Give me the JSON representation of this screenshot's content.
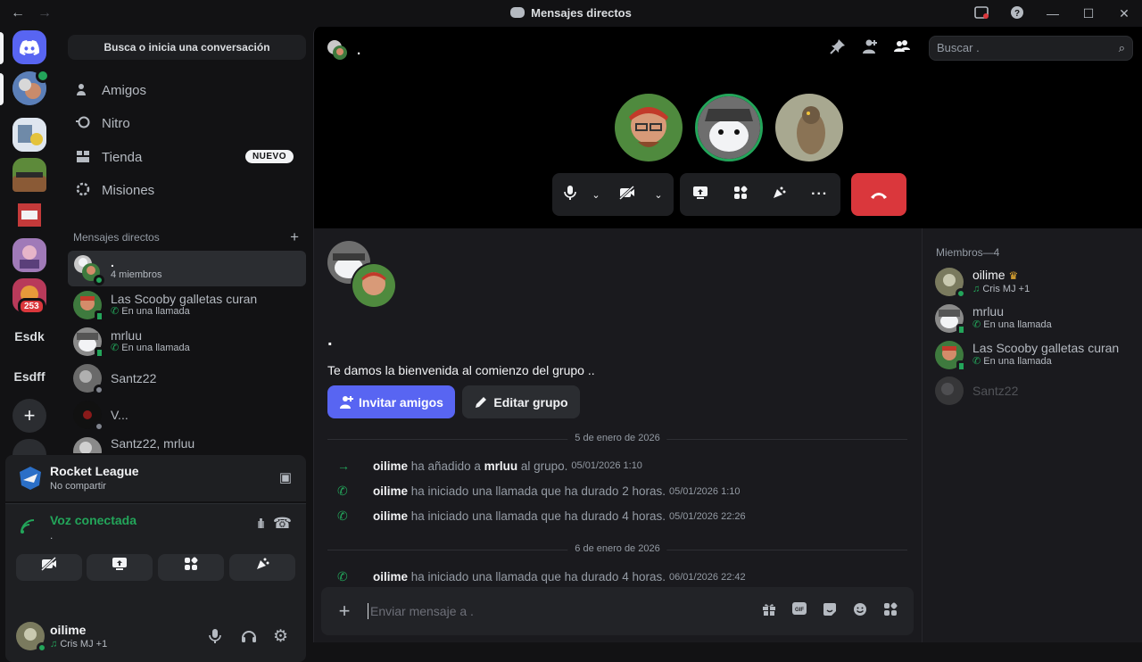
{
  "titlebar": {
    "title": "Mensajes directos",
    "back": "←",
    "forward": "→",
    "icons": [
      "inbox-icon",
      "help-icon",
      "minimize-icon",
      "maximize-icon",
      "close-icon"
    ]
  },
  "rail": {
    "servers": [
      {
        "id": "home",
        "label": ""
      },
      {
        "id": "Esdk",
        "label": "Esdk"
      },
      {
        "id": "Esdff",
        "label": "Esdff"
      }
    ],
    "badge": "253"
  },
  "sidebar": {
    "search_label": "Busca o inicia una conversación",
    "nav": [
      {
        "label": "Amigos",
        "icon": "friends-icon"
      },
      {
        "label": "Nitro",
        "icon": "nitro-icon"
      },
      {
        "label": "Tienda",
        "icon": "shop-icon",
        "badge": "NUEVO"
      },
      {
        "label": "Misiones",
        "icon": "quests-icon"
      }
    ],
    "dm_header": "Mensajes directos",
    "dms": [
      {
        "name": ".",
        "sub": "4 miembros",
        "active": true
      },
      {
        "name": "Las Scooby galletas curan",
        "sub": "En una llamada"
      },
      {
        "name": "mrluu",
        "sub": "En una llamada"
      },
      {
        "name": "Santz22",
        "sub": ""
      },
      {
        "name": "V...",
        "sub": ""
      },
      {
        "name": "Santz22, mrluu",
        "sub": ""
      }
    ]
  },
  "activity": {
    "game": "Rocket League",
    "status": "No compartir"
  },
  "voice": {
    "status": "Voz conectada",
    "channel": "."
  },
  "user": {
    "name": "oilime",
    "status": "Cris MJ +1"
  },
  "header": {
    "group_name": ".",
    "search_placeholder": "Buscar ."
  },
  "call": {
    "hangup": "⏻"
  },
  "chat": {
    "group_name": ".",
    "welcome": "Te damos la bienvenida al comienzo del grupo ..",
    "invite_label": "Invitar amigos",
    "edit_label": "Editar grupo",
    "day1": "5 de enero de 2026",
    "day2": "6 de enero de 2026",
    "messages": [
      {
        "user": "oilime",
        "pre": " ha añadido a ",
        "target": "mrluu",
        "post": " al grupo.",
        "ts": "05/01/2026 1:10",
        "icon": "arrow-icon"
      },
      {
        "user": "oilime",
        "pre": " ha iniciado una llamada que ha durado 2 horas.",
        "target": "",
        "post": "",
        "ts": "05/01/2026 1:10",
        "icon": "phone-icon"
      },
      {
        "user": "oilime",
        "pre": " ha iniciado una llamada que ha durado 4 horas.",
        "target": "",
        "post": "",
        "ts": "05/01/2026 22:26",
        "icon": "phone-icon"
      },
      {
        "user": "oilime",
        "pre": " ha iniciado una llamada que ha durado 4 horas.",
        "target": "",
        "post": "",
        "ts": "06/01/2026 22:42",
        "icon": "phone-icon"
      }
    ],
    "composer_placeholder": "Enviar mensaje a ."
  },
  "members": {
    "header": "Miembros—4",
    "list": [
      {
        "name": "oilime",
        "sub": "Cris MJ +1"
      },
      {
        "name": "mrluu",
        "sub": "En una llamada"
      },
      {
        "name": "Las Scooby galletas curan",
        "sub": "En una llamada"
      },
      {
        "name": "Santz22",
        "sub": ""
      }
    ]
  },
  "colors": {
    "accent": "#5865f2",
    "online": "#23a55a",
    "danger": "#da373c"
  }
}
